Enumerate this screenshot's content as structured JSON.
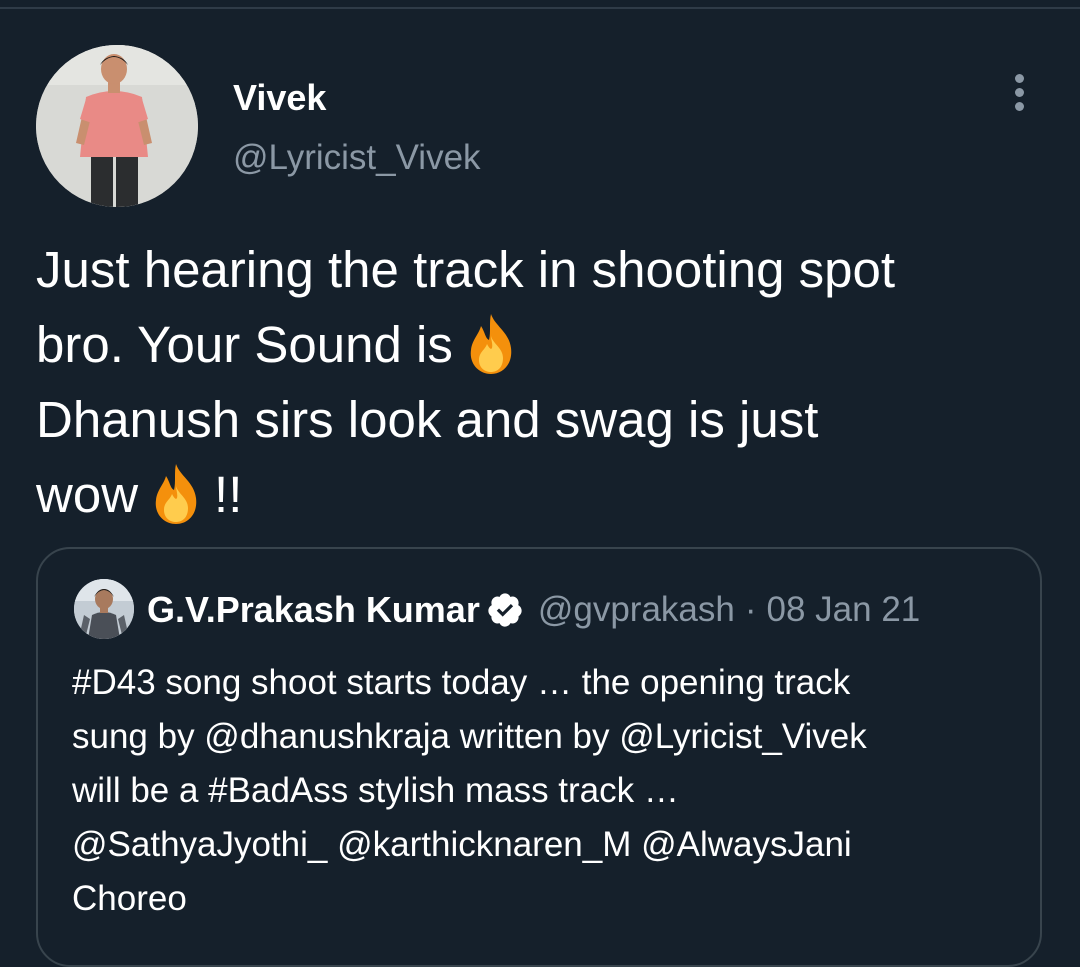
{
  "tweet": {
    "author": {
      "name": "Vivek",
      "handle": "@Lyricist_Vivek"
    },
    "more_icon": "more-vertical-icon",
    "text_lines": [
      "Just hearing the track in shooting spot",
      "bro. Your Sound is",
      "Dhanush sirs look and swag is just",
      "wow",
      "!!"
    ],
    "emoji": "fire-emoji"
  },
  "quoted_tweet": {
    "author": {
      "name": "G.V.Prakash Kumar",
      "handle": "@gvprakash",
      "verified": true
    },
    "separator": "·",
    "date": "08 Jan 21",
    "text_lines": [
      "#D43 song shoot starts today … the opening track",
      "sung by @dhanushkraja written by @Lyricist_Vivek",
      "will be a #BadAss stylish mass track …",
      "@SathyaJyothi_ @karthicknaren_M @AlwaysJani",
      "Choreo"
    ]
  },
  "colors": {
    "background": "#15202b",
    "text_primary": "#ffffff",
    "text_secondary": "#8b98a5",
    "border": "#38444d"
  }
}
